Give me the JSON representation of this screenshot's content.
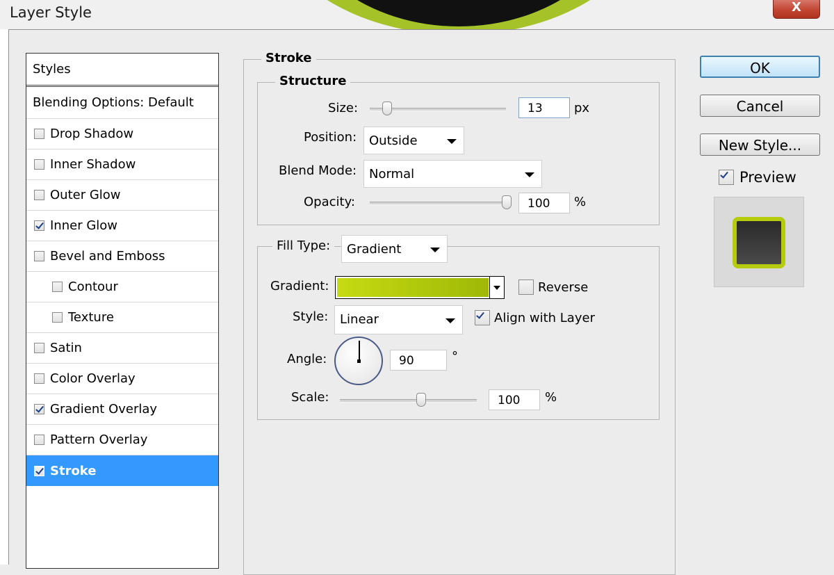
{
  "window": {
    "title": "Layer Style",
    "close_label": "X"
  },
  "styles_list": {
    "header": "Styles",
    "items": [
      {
        "label": "Blending Options: Default",
        "has_checkbox": false,
        "checked": false,
        "indent": false,
        "selected": false
      },
      {
        "label": "Drop Shadow",
        "has_checkbox": true,
        "checked": false,
        "indent": false,
        "selected": false
      },
      {
        "label": "Inner Shadow",
        "has_checkbox": true,
        "checked": false,
        "indent": false,
        "selected": false
      },
      {
        "label": "Outer Glow",
        "has_checkbox": true,
        "checked": false,
        "indent": false,
        "selected": false
      },
      {
        "label": "Inner Glow",
        "has_checkbox": true,
        "checked": true,
        "indent": false,
        "selected": false
      },
      {
        "label": "Bevel and Emboss",
        "has_checkbox": true,
        "checked": false,
        "indent": false,
        "selected": false
      },
      {
        "label": "Contour",
        "has_checkbox": true,
        "checked": false,
        "indent": true,
        "selected": false
      },
      {
        "label": "Texture",
        "has_checkbox": true,
        "checked": false,
        "indent": true,
        "selected": false
      },
      {
        "label": "Satin",
        "has_checkbox": true,
        "checked": false,
        "indent": false,
        "selected": false
      },
      {
        "label": "Color Overlay",
        "has_checkbox": true,
        "checked": false,
        "indent": false,
        "selected": false
      },
      {
        "label": "Gradient Overlay",
        "has_checkbox": true,
        "checked": true,
        "indent": false,
        "selected": false
      },
      {
        "label": "Pattern Overlay",
        "has_checkbox": true,
        "checked": false,
        "indent": false,
        "selected": false
      },
      {
        "label": "Stroke",
        "has_checkbox": true,
        "checked": true,
        "indent": false,
        "selected": true
      }
    ]
  },
  "stroke": {
    "legend": "Stroke",
    "structure": {
      "legend": "Structure",
      "size_label": "Size:",
      "size_value": "13",
      "size_unit": "px",
      "size_slider_fraction": 0.1,
      "position_label": "Position:",
      "position_value": "Outside",
      "blend_label": "Blend Mode:",
      "blend_value": "Normal",
      "opacity_label": "Opacity:",
      "opacity_value": "100",
      "opacity_unit": "%",
      "opacity_slider_fraction": 1.0
    },
    "fill": {
      "fill_type_label": "Fill Type:",
      "fill_type_value": "Gradient",
      "gradient_label": "Gradient:",
      "gradient_colors": [
        "#c5db12",
        "#9fb806"
      ],
      "reverse_label": "Reverse",
      "reverse_checked": false,
      "style_label": "Style:",
      "style_value": "Linear",
      "align_label": "Align with Layer",
      "align_checked": true,
      "angle_label": "Angle:",
      "angle_value": "90",
      "angle_unit": "°",
      "scale_label": "Scale:",
      "scale_value": "100",
      "scale_unit": "%",
      "scale_slider_fraction": 0.6
    }
  },
  "buttons": {
    "ok": "OK",
    "cancel": "Cancel",
    "new_style": "New Style..."
  },
  "preview": {
    "label": "Preview",
    "checked": true,
    "stroke_color": "#b5cc0e",
    "fill_color": "#2a2a2a"
  },
  "colors": {
    "selection": "#3399ff",
    "dialog_bg": "#ececec"
  }
}
